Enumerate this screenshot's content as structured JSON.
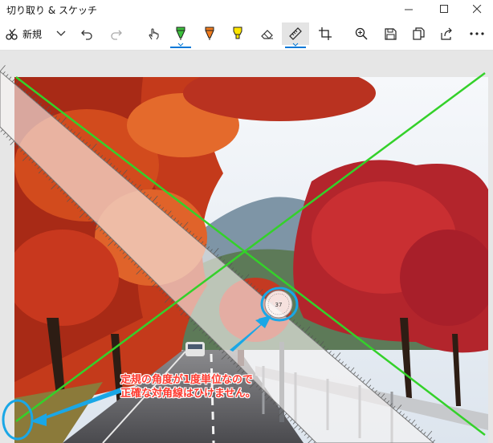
{
  "window": {
    "title": "切り取り & スケッチ",
    "controls": [
      "minimize",
      "maximize",
      "close"
    ]
  },
  "toolbar": {
    "new_label": "新規",
    "items": [
      {
        "name": "new-snip",
        "icon": "snip-icon"
      },
      {
        "name": "new-dropdown",
        "icon": "chevron-down-icon"
      },
      {
        "name": "undo",
        "icon": "undo-icon"
      },
      {
        "name": "redo",
        "icon": "redo-icon"
      },
      {
        "name": "touch-writing",
        "icon": "touch-hand-icon"
      },
      {
        "name": "ballpoint-pen",
        "icon": "pen-icon",
        "color": "#3cc13c",
        "selected": true
      },
      {
        "name": "pencil",
        "icon": "pencil-icon",
        "color": "#f07c1e"
      },
      {
        "name": "highlighter",
        "icon": "highlighter-icon",
        "color": "#ffe600"
      },
      {
        "name": "eraser",
        "icon": "eraser-icon"
      },
      {
        "name": "ruler",
        "icon": "ruler-icon",
        "selected": true
      },
      {
        "name": "crop",
        "icon": "crop-icon"
      },
      {
        "name": "zoom",
        "icon": "zoom-icon"
      },
      {
        "name": "save",
        "icon": "save-icon"
      },
      {
        "name": "copy",
        "icon": "copy-icon"
      },
      {
        "name": "share",
        "icon": "share-icon"
      },
      {
        "name": "more",
        "icon": "more-icon"
      }
    ]
  },
  "annotation": {
    "caption_line1": "定規の角度が1度単位なので",
    "caption_line2": "正確な対角線はひけません。",
    "caption_color": "#ff3b30",
    "arrow_color": "#1aa7e6",
    "line_color": "#34d12a"
  },
  "ruler": {
    "angle_readout": "37"
  },
  "colors": {
    "accent": "#0078d7",
    "pen_green": "#3cc13c",
    "pencil_orange": "#f07c1e",
    "highlighter_yellow": "#ffe600"
  }
}
